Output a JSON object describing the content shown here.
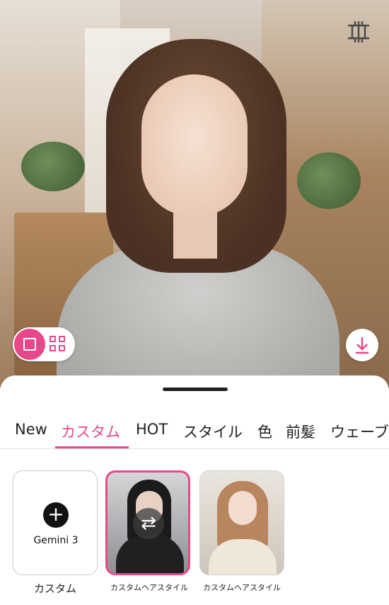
{
  "photo": {
    "crop_icon": "crop-icon"
  },
  "view_toggle": {
    "active": "single",
    "icons": [
      "single-view-icon",
      "grid-view-icon"
    ]
  },
  "download": {
    "icon": "download-icon"
  },
  "tabs": [
    {
      "label": "New",
      "active": false
    },
    {
      "label": "カスタム",
      "active": true
    },
    {
      "label": "HOT",
      "active": false
    },
    {
      "label": "スタイル",
      "active": false
    },
    {
      "label": "色",
      "active": false
    },
    {
      "label": "前髪",
      "active": false
    },
    {
      "label": "ウェーブ",
      "active": false
    }
  ],
  "cards": [
    {
      "title": "Gemini 3",
      "caption": "カスタム"
    },
    {
      "caption": "カスタムヘアスタイル",
      "selected": true
    },
    {
      "caption": "カスタムヘアスタイル"
    }
  ],
  "colors": {
    "accent": "#e9478b"
  }
}
